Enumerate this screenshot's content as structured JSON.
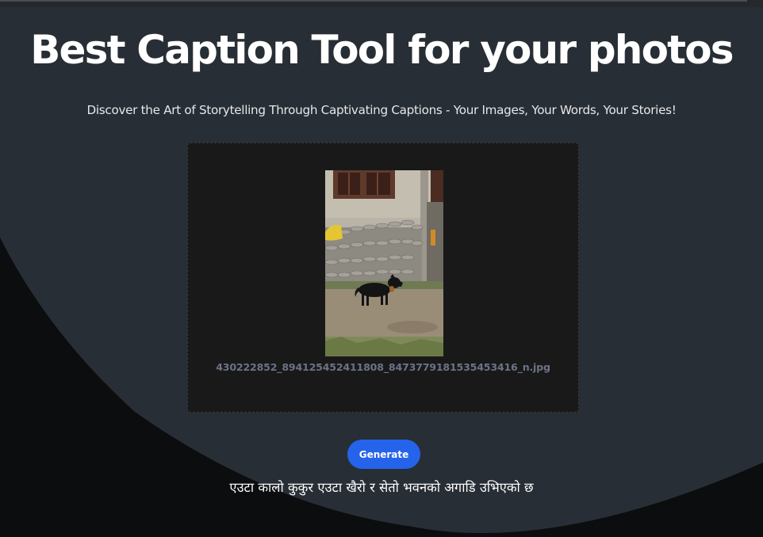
{
  "header": {
    "title": "Best Caption Tool for your photos",
    "subtitle": "Discover the Art of Storytelling Through Captivating Captions - Your Images, Your Words, Your Stories!"
  },
  "upload": {
    "filename": "430222852_894125452411808_8473779181535453416_n.jpg"
  },
  "actions": {
    "generate_label": "Generate"
  },
  "result": {
    "caption": "एउटा कालो कुकुर एउटा खैरो र सेतो भवनको अगाडि उभिएको छ"
  },
  "colors": {
    "background_panel": "#282e35",
    "background_dark": "#0b0d0f",
    "dropzone": "#191919",
    "accent": "#2563eb",
    "filename_text": "#6b7385"
  }
}
